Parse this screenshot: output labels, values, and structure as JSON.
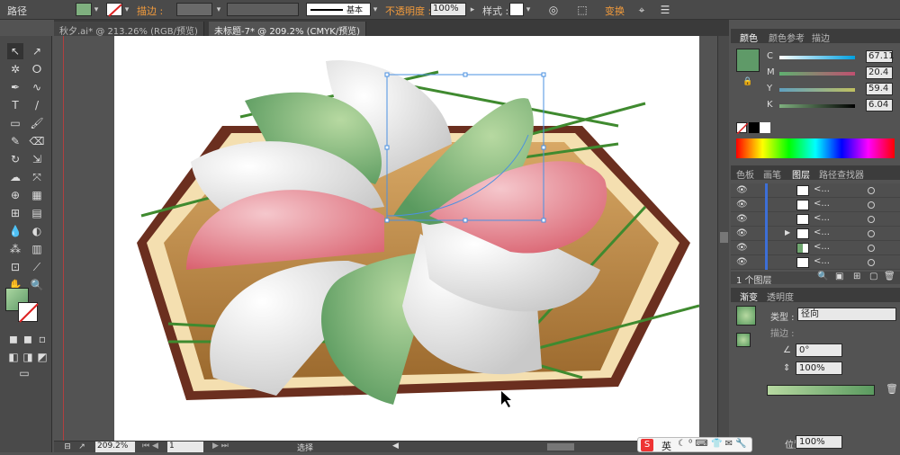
{
  "control_bar": {
    "object_type": "路径",
    "stroke_label": "描边 :",
    "stroke_style": "基本",
    "opacity_label": "不透明度 :",
    "opacity_value": "100%",
    "style_label": "样式 :",
    "transform_label": "变换"
  },
  "tabs": [
    {
      "label": "秋夕.ai* @ 213.26% (RGB/预览)"
    },
    {
      "label": "未标题-7* @ 209.2% (CMYK/预览)"
    }
  ],
  "status": {
    "zoom": "209.2%",
    "page": "1",
    "tool": "选择"
  },
  "color_panel": {
    "tabs": [
      "颜色",
      "颜色参考",
      "描边"
    ],
    "c_label": "C",
    "c_value": "67.11",
    "m_label": "M",
    "m_value": "20.4",
    "y_label": "Y",
    "y_value": "59.4",
    "k_label": "K",
    "k_value": "6.04",
    "fill_color": "#5f9a68"
  },
  "layers_panel": {
    "tabs": [
      "色板",
      "画笔",
      "图层",
      "路径查找器"
    ],
    "rows": [
      {
        "name": "<..."
      },
      {
        "name": "<..."
      },
      {
        "name": "<..."
      },
      {
        "name": "<..."
      },
      {
        "name": "<..."
      },
      {
        "name": "<..."
      }
    ],
    "footer": "1 个图层"
  },
  "gradient_panel": {
    "tabs": [
      "渐变",
      "透明度"
    ],
    "type_label": "类型 :",
    "type_value": "径向",
    "stroke_label": "描边 :",
    "angle_value": "0°",
    "ratio_value": "100%",
    "location_label": "位置 :",
    "location_value": "100%"
  },
  "taskbar": {
    "ime_label": "英"
  },
  "colors": {
    "green": "#6fa56f",
    "pink": "#e07f8c",
    "white": "#f5f5f5",
    "wood": "#b07a3c",
    "selection": "#4a90e2"
  }
}
